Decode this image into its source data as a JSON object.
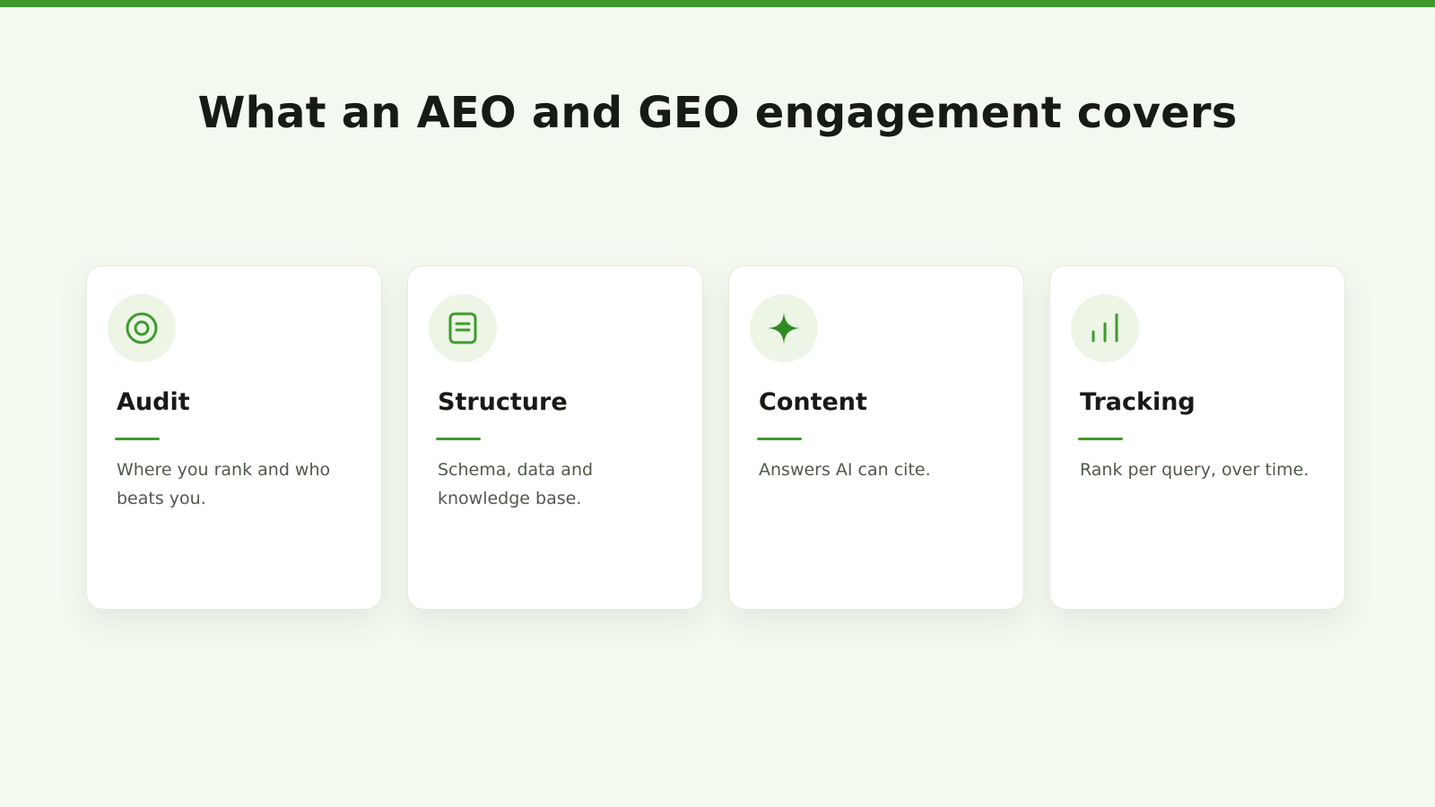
{
  "page": {
    "title": "What an AEO and GEO engagement covers"
  },
  "theme": {
    "accent": "#3f9a2e",
    "background": "#f4f9f0",
    "card_background": "#ffffff",
    "icon_background": "#ecf5e6"
  },
  "cards": [
    {
      "icon": "target-icon",
      "title": "Audit",
      "description": "Where you rank and who beats you."
    },
    {
      "icon": "document-icon",
      "title": "Structure",
      "description": "Schema, data and knowledge base."
    },
    {
      "icon": "sparkle-icon",
      "title": "Content",
      "description": "Answers AI can cite."
    },
    {
      "icon": "bar-chart-icon",
      "title": "Tracking",
      "description": "Rank per query, over time."
    }
  ]
}
